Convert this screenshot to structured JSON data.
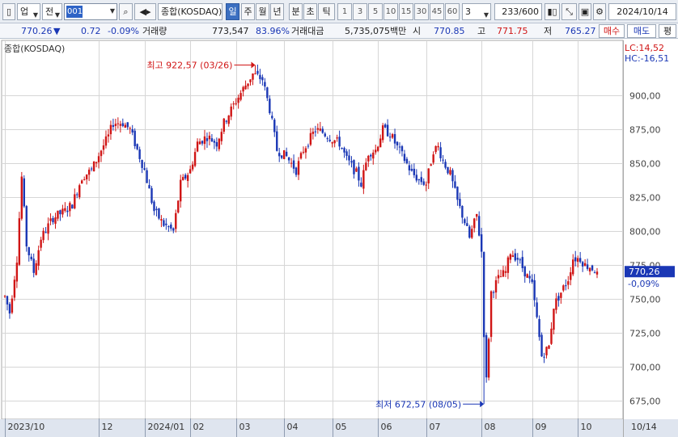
{
  "toolbar": {
    "market_label": "업",
    "period_label": "전",
    "code": "001",
    "name": "종합(KOSDAQ)",
    "periods": [
      "일",
      "주",
      "월",
      "년",
      "분",
      "초",
      "틱"
    ],
    "selected_period": "일",
    "intervals": [
      "1",
      "3",
      "5",
      "10",
      "15",
      "30",
      "45",
      "60"
    ],
    "interval_value": "3",
    "count_current": "233",
    "count_total": "/600",
    "date": "2024/10/14"
  },
  "quote": {
    "price": "770.26",
    "change_arrow": "▼",
    "change": "0.72",
    "change_pct": "-0.09%",
    "volume_label": "거래량",
    "volume": "773,547",
    "volume_ratio": "83.96%",
    "amount_label": "거래대금",
    "amount": "5,735,075백만",
    "open_label": "시",
    "open": "770.85",
    "high_label": "고",
    "high": "771.75",
    "low_label": "저",
    "low": "765.27",
    "buy_label": "매수",
    "sell_label": "매도",
    "eval_label": "평"
  },
  "colors": {
    "up": "#d01515",
    "down": "#1a37b5",
    "grid": "#d6d6d6",
    "axis_bg": "#dfe5ef",
    "price_tag": "#1a37b5"
  },
  "chart_data": {
    "type": "candlestick",
    "title": "종합(KOSDAQ)",
    "ylim": [
      662,
      936
    ],
    "y_ticks": [
      675,
      700,
      725,
      750,
      775,
      800,
      825,
      850,
      875,
      900
    ],
    "y_tick_labels": [
      "675,00",
      "700,00",
      "725,00",
      "750,00",
      "775,00",
      "800,00",
      "825,00",
      "850,00",
      "875,00",
      "900,00"
    ],
    "x_labels": [
      {
        "label": "2023/10",
        "index": 0
      },
      {
        "label": "12",
        "index": 39
      },
      {
        "label": "2024/01",
        "index": 58
      },
      {
        "label": "02",
        "index": 77
      },
      {
        "label": "03",
        "index": 96
      },
      {
        "label": "04",
        "index": 116
      },
      {
        "label": "05",
        "index": 136
      },
      {
        "label": "06",
        "index": 155
      },
      {
        "label": "07",
        "index": 175
      },
      {
        "label": "08",
        "index": 198
      },
      {
        "label": "09",
        "index": 219
      },
      {
        "label": "10",
        "index": 238
      }
    ],
    "axis_last_label": "10/14",
    "count": 247,
    "keypoints": [
      [
        0,
        752
      ],
      [
        2,
        740
      ],
      [
        5,
        780
      ],
      [
        7,
        840
      ],
      [
        9,
        790
      ],
      [
        12,
        770
      ],
      [
        15,
        795
      ],
      [
        20,
        810
      ],
      [
        25,
        815
      ],
      [
        28,
        820
      ],
      [
        32,
        840
      ],
      [
        36,
        845
      ],
      [
        40,
        860
      ],
      [
        43,
        870
      ],
      [
        45,
        880
      ],
      [
        49,
        880
      ],
      [
        52,
        875
      ],
      [
        55,
        860
      ],
      [
        58,
        845
      ],
      [
        62,
        815
      ],
      [
        66,
        805
      ],
      [
        70,
        800
      ],
      [
        73,
        835
      ],
      [
        77,
        845
      ],
      [
        80,
        865
      ],
      [
        84,
        870
      ],
      [
        88,
        865
      ],
      [
        91,
        880
      ],
      [
        95,
        893
      ],
      [
        99,
        905
      ],
      [
        103,
        916
      ],
      [
        107,
        912
      ],
      [
        110,
        890
      ],
      [
        113,
        860
      ],
      [
        117,
        855
      ],
      [
        121,
        845
      ],
      [
        124,
        860
      ],
      [
        129,
        875
      ],
      [
        132,
        873
      ],
      [
        136,
        868
      ],
      [
        139,
        865
      ],
      [
        142,
        853
      ],
      [
        146,
        843
      ],
      [
        148,
        835
      ],
      [
        151,
        858
      ],
      [
        154,
        860
      ],
      [
        157,
        875
      ],
      [
        160,
        872
      ],
      [
        163,
        862
      ],
      [
        166,
        853
      ],
      [
        169,
        843
      ],
      [
        172,
        838
      ],
      [
        175,
        835
      ],
      [
        178,
        860
      ],
      [
        180,
        862
      ],
      [
        182,
        852
      ],
      [
        185,
        842
      ],
      [
        188,
        822
      ],
      [
        191,
        807
      ],
      [
        193,
        795
      ],
      [
        196,
        812
      ],
      [
        198,
        785
      ],
      [
        199,
        725
      ],
      [
        200,
        690
      ],
      [
        202,
        755
      ],
      [
        205,
        765
      ],
      [
        208,
        770
      ],
      [
        210,
        785
      ],
      [
        213,
        780
      ],
      [
        216,
        770
      ],
      [
        219,
        760
      ],
      [
        221,
        735
      ],
      [
        223,
        708
      ],
      [
        226,
        715
      ],
      [
        228,
        745
      ],
      [
        231,
        755
      ],
      [
        234,
        765
      ],
      [
        236,
        780
      ],
      [
        239,
        780
      ],
      [
        241,
        775
      ],
      [
        243,
        774
      ],
      [
        246,
        770.26
      ]
    ],
    "annotations": [
      {
        "text": "최고 922,57 (03/26)",
        "index": 104,
        "value": 922.57,
        "side": "left",
        "color": "#d01515"
      },
      {
        "text": "최저 672,57 (08/05)",
        "index": 199,
        "value": 672.57,
        "side": "left",
        "color": "#1a37b5"
      }
    ],
    "lc_label": "LC:14,52",
    "hc_label": "HC:-16,51",
    "last_price_label": "770,26",
    "last_change_label": "-0,09%"
  }
}
